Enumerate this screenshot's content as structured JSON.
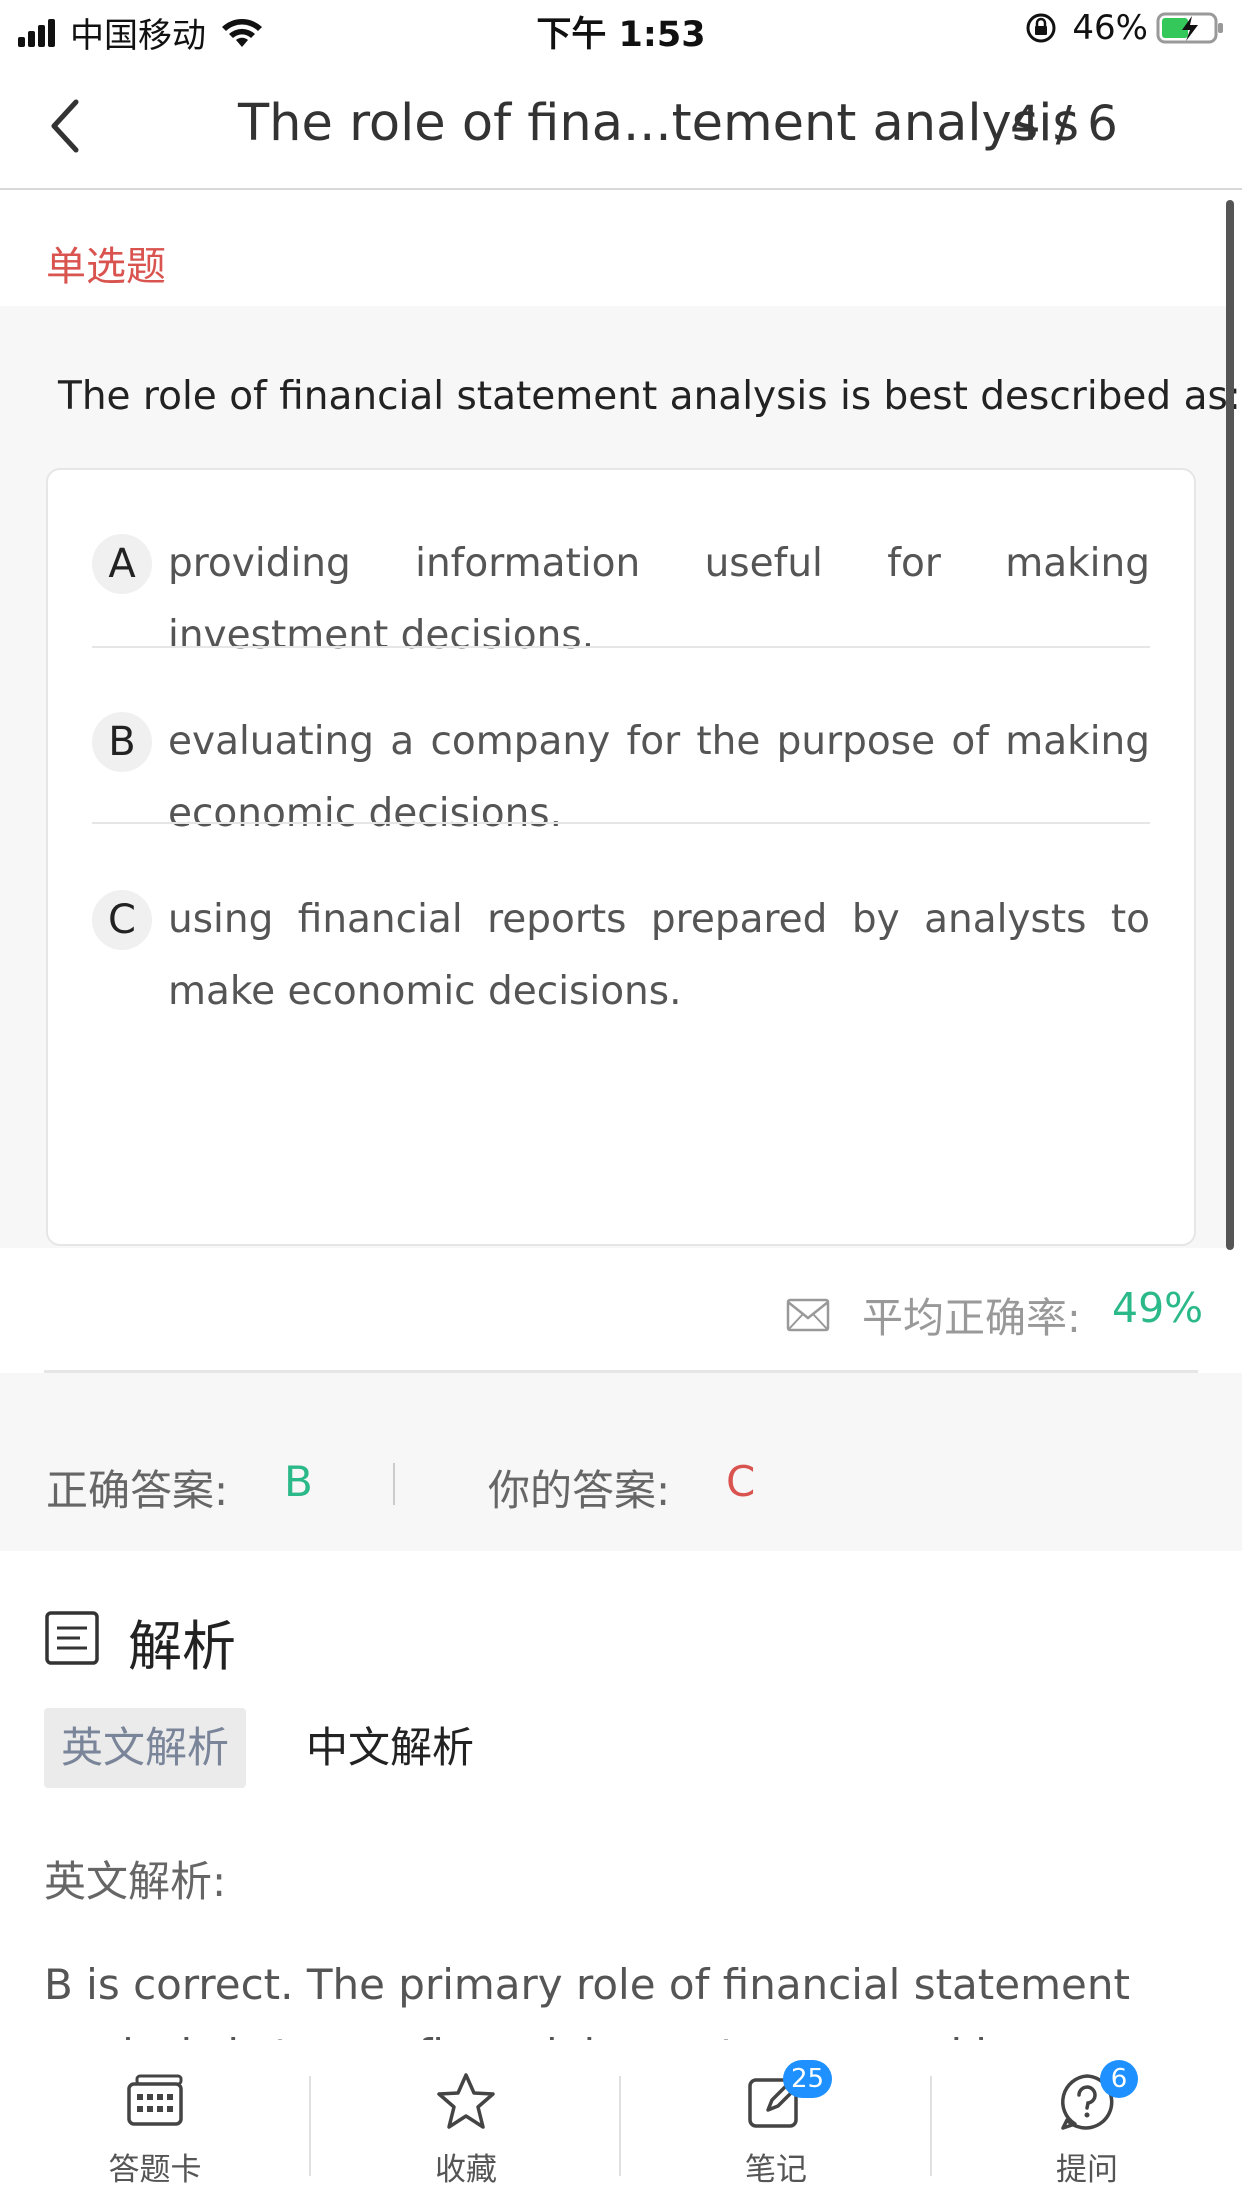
{
  "status_bar": {
    "carrier": "中国移动",
    "time": "下午 1:53",
    "battery": "46%"
  },
  "nav": {
    "title": "The role of fina...tement analysis",
    "count": "4 / 6"
  },
  "question": {
    "type": "单选题",
    "stem": "The role of financial statement analysis is best described as:",
    "options": [
      {
        "letter": "A",
        "text": "providing information useful for making investment decisions."
      },
      {
        "letter": "B",
        "text": "evaluating a company for the purpose of making economic decisions."
      },
      {
        "letter": "C",
        "text": "using financial reports prepared by analysts to make economic decisions."
      }
    ]
  },
  "accuracy": {
    "label": "平均正确率:",
    "value": "49%"
  },
  "answers": {
    "correct_label": "正确答案:",
    "correct_value": "B",
    "user_label": "你的答案:",
    "user_value": "C"
  },
  "analysis": {
    "title": "解析",
    "tabs": [
      "英文解析",
      "中文解析"
    ],
    "en_label": "英文解析:",
    "text_line1": "B is correct. The primary role of financial statement",
    "text_line2": "analysis is to use financial reports prepared by companies"
  },
  "tab_bar": {
    "items": [
      {
        "label": "答题卡",
        "icon": "answer-card-icon"
      },
      {
        "label": "收藏",
        "icon": "star-icon"
      },
      {
        "label": "笔记",
        "icon": "note-edit-icon",
        "badge": "25"
      },
      {
        "label": "提问",
        "icon": "question-icon",
        "badge": "6"
      }
    ]
  },
  "colors": {
    "red": "#d9534f",
    "green": "#2cb98a",
    "badge": "#1e90ff"
  }
}
